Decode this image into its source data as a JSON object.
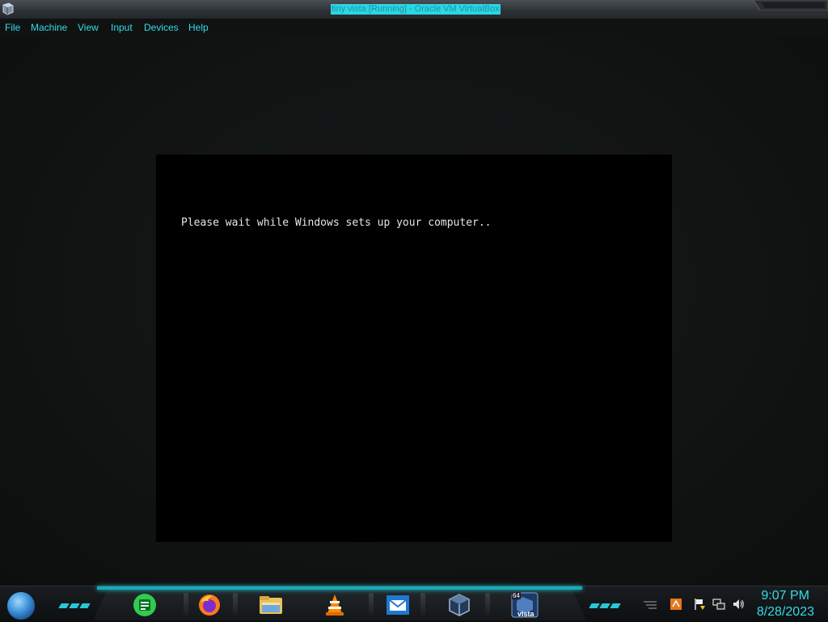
{
  "window": {
    "title": "tiny vista [Running] - Oracle VM VirtualBox"
  },
  "menu": {
    "items": [
      "File",
      "Machine",
      "View",
      "Input",
      "Devices",
      "Help"
    ]
  },
  "vm": {
    "status_text": "Please wait while Windows sets up your computer.."
  },
  "taskbar": {
    "start_icon": "windows-orb-icon",
    "apps": [
      {
        "name": "notes-app",
        "icon": "notes-icon"
      },
      {
        "name": "firefox",
        "icon": "firefox-icon"
      },
      {
        "name": "file-explorer",
        "icon": "folder-icon"
      },
      {
        "name": "vlc",
        "icon": "vlc-cone-icon"
      },
      {
        "name": "mail",
        "icon": "mail-icon"
      },
      {
        "name": "virtualbox",
        "icon": "virtualbox-icon"
      },
      {
        "name": "vista-vm",
        "icon": "vista-vm-icon",
        "badge": "64",
        "label": "vista"
      }
    ],
    "tray": {
      "icons": [
        "show-hidden-icon",
        "updates-icon",
        "action-center-flag-icon",
        "network-icon",
        "volume-icon"
      ],
      "time": "9:07 PM",
      "date": "8/28/2023"
    },
    "accent_color": "#27c9d6"
  }
}
